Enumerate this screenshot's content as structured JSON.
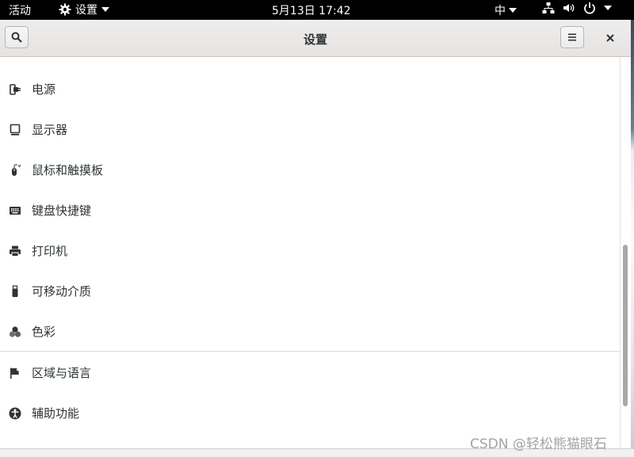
{
  "topbar": {
    "activities": "活动",
    "app_menu": "设置",
    "clock": "5月13日  17:42",
    "input_method": "中"
  },
  "headerbar": {
    "title": "设置"
  },
  "sidebar": {
    "items": [
      {
        "label": "电源",
        "icon": "power-plug-icon"
      },
      {
        "label": "显示器",
        "icon": "display-icon"
      },
      {
        "label": "鼠标和触摸板",
        "icon": "mouse-icon"
      },
      {
        "label": "键盘快捷键",
        "icon": "keyboard-icon"
      },
      {
        "label": "打印机",
        "icon": "printer-icon"
      },
      {
        "label": "可移动介质",
        "icon": "usb-drive-icon"
      },
      {
        "label": "色彩",
        "icon": "color-circles-icon"
      },
      {
        "label": "区域与语言",
        "icon": "flag-icon"
      },
      {
        "label": "辅助功能",
        "icon": "accessibility-icon"
      }
    ]
  },
  "watermark": "CSDN @轻松熊猫眼石"
}
